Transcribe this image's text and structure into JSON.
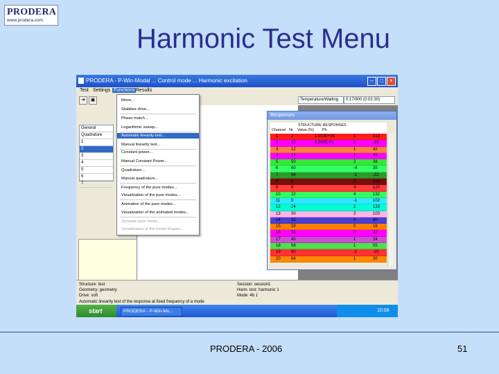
{
  "logo": {
    "name": "PRODERA",
    "url": "www.prodera.com"
  },
  "slide_title": "Harmonic Test Menu",
  "footer": {
    "center": "PRODERA - 2006",
    "page": "51"
  },
  "app": {
    "window_title": "PRODERA - P-Win-Modal ... Control mode ... Harmonic excitation",
    "menu": [
      "Test",
      "Settings",
      "Functions",
      "Results"
    ],
    "toolbar_combo_left": "Temperature/Waiting",
    "toolbar_combo_right": "0:17/900 (0:02:30)",
    "left_list": [
      "General",
      "Quadrature",
      "1",
      "2",
      "3",
      "4",
      "5",
      "6",
      "7",
      "8"
    ],
    "functions_menu": [
      {
        "label": "Move...",
        "state": "normal"
      },
      {
        "label": "Stabilize drive...",
        "state": "normal"
      },
      {
        "label": "Phase match...",
        "state": "normal"
      },
      {
        "label": "Logarithmic sweep...",
        "state": "normal"
      },
      {
        "label": "Automatic linearity test...",
        "state": "highlight"
      },
      {
        "label": "Manual linearity test...",
        "state": "normal"
      },
      {
        "label": "Constant power...",
        "state": "normal"
      },
      {
        "label": "Manual Constant Power...",
        "state": "normal"
      },
      {
        "label": "Quadrature...",
        "state": "normal"
      },
      {
        "label": "Manual quadrature...",
        "state": "normal"
      },
      {
        "label": "Frequency of the pure modes...",
        "state": "normal"
      },
      {
        "label": "Visualization of the pure modes...",
        "state": "normal"
      },
      {
        "label": "Animation of the pure modes...",
        "state": "normal"
      },
      {
        "label": "Visualization of the animated modes...",
        "state": "normal"
      },
      {
        "label": "Simulate pure mode...",
        "state": "disabled"
      },
      {
        "label": "Visualization of the mode shapes...",
        "state": "disabled"
      }
    ],
    "responses": {
      "title": "Responses",
      "header_group": "STRUCTURE RESPONSES",
      "columns": [
        "Channel",
        "Nr",
        "Value (%)",
        "Ph"
      ],
      "rows": [
        {
          "ch": "1",
          "nr": "2",
          "val": "1.000E+00",
          "ph": "1",
          "v": "313",
          "color": "#ff1c1c"
        },
        {
          "ch": "2",
          "nr": "10",
          "val": "8.500E-01",
          "ph": "0",
          "v": "-16",
          "color": "#ff00ff"
        },
        {
          "ch": "3",
          "nr": "12",
          "val": "",
          "ph": "1",
          "v": "42",
          "color": "#ff7f3f"
        },
        {
          "ch": "4",
          "nr": "14",
          "val": "",
          "ph": "1",
          "v": "45",
          "color": "#ff00ff"
        },
        {
          "ch": "5",
          "nr": "50",
          "val": "",
          "ph": "2",
          "v": "38",
          "color": "#34e83a"
        },
        {
          "ch": "6",
          "nr": "60",
          "val": "",
          "ph": "-4",
          "v": "35",
          "color": "#33ff66"
        },
        {
          "ch": "7",
          "nr": "64",
          "val": "",
          "ph": "-1",
          "v": "-22",
          "color": "#2b9a2b"
        },
        {
          "ch": "8",
          "nr": "2",
          "val": "",
          "ph": "2",
          "v": "313",
          "color": "#7a0d0d"
        },
        {
          "ch": "9",
          "nr": "8",
          "val": "",
          "ph": "4",
          "v": "120",
          "color": "#ff3b3b"
        },
        {
          "ch": "10",
          "nr": "22",
          "val": "",
          "ph": "4",
          "v": "132",
          "color": "#35ff60"
        },
        {
          "ch": "11",
          "nr": "0",
          "val": "",
          "ph": "-1",
          "v": "102",
          "color": "#2ee8ff"
        },
        {
          "ch": "12",
          "nr": "24",
          "val": "",
          "ph": "2",
          "v": "133",
          "color": "#00ffd5"
        },
        {
          "ch": "13",
          "nr": "30",
          "val": "",
          "ph": "3",
          "v": "103",
          "color": "#ffb3e6"
        },
        {
          "ch": "14",
          "nr": "32",
          "val": "",
          "ph": "0",
          "v": "90",
          "color": "#4b3fd6"
        },
        {
          "ch": "15",
          "nr": "28",
          "val": "",
          "ph": "0",
          "v": "16",
          "color": "#ff7f00"
        },
        {
          "ch": "16",
          "nr": "36",
          "val": "",
          "ph": "0",
          "v": "32",
          "color": "#ff00ff"
        },
        {
          "ch": "17",
          "nr": "40",
          "val": "",
          "ph": "1",
          "v": "34",
          "color": "#c94fd1"
        },
        {
          "ch": "18",
          "nr": "58",
          "val": "",
          "ph": "1",
          "v": "55",
          "color": "#4be34b"
        },
        {
          "ch": "19",
          "nr": "60",
          "val": "",
          "ph": "-1",
          "v": "-20",
          "color": "#ff3030"
        },
        {
          "ch": "20",
          "nr": "64",
          "val": "",
          "ph": "1",
          "v": "30",
          "color": "#ff8800"
        }
      ]
    },
    "status": {
      "left_1": "Structure: test",
      "left_2": "Geometry: geometry",
      "left_3": "Drive: soft",
      "right_1": "Session: session1",
      "right_2": "Harm. test: harmonic 1",
      "right_3": "Mode: 4b 1",
      "bottom": "Automatic linearity test of the response at fixed frequency of a mode"
    },
    "taskbar": {
      "start": "start",
      "task": "PRODERA - P-Win-Mo...",
      "clock": "10:08"
    }
  }
}
